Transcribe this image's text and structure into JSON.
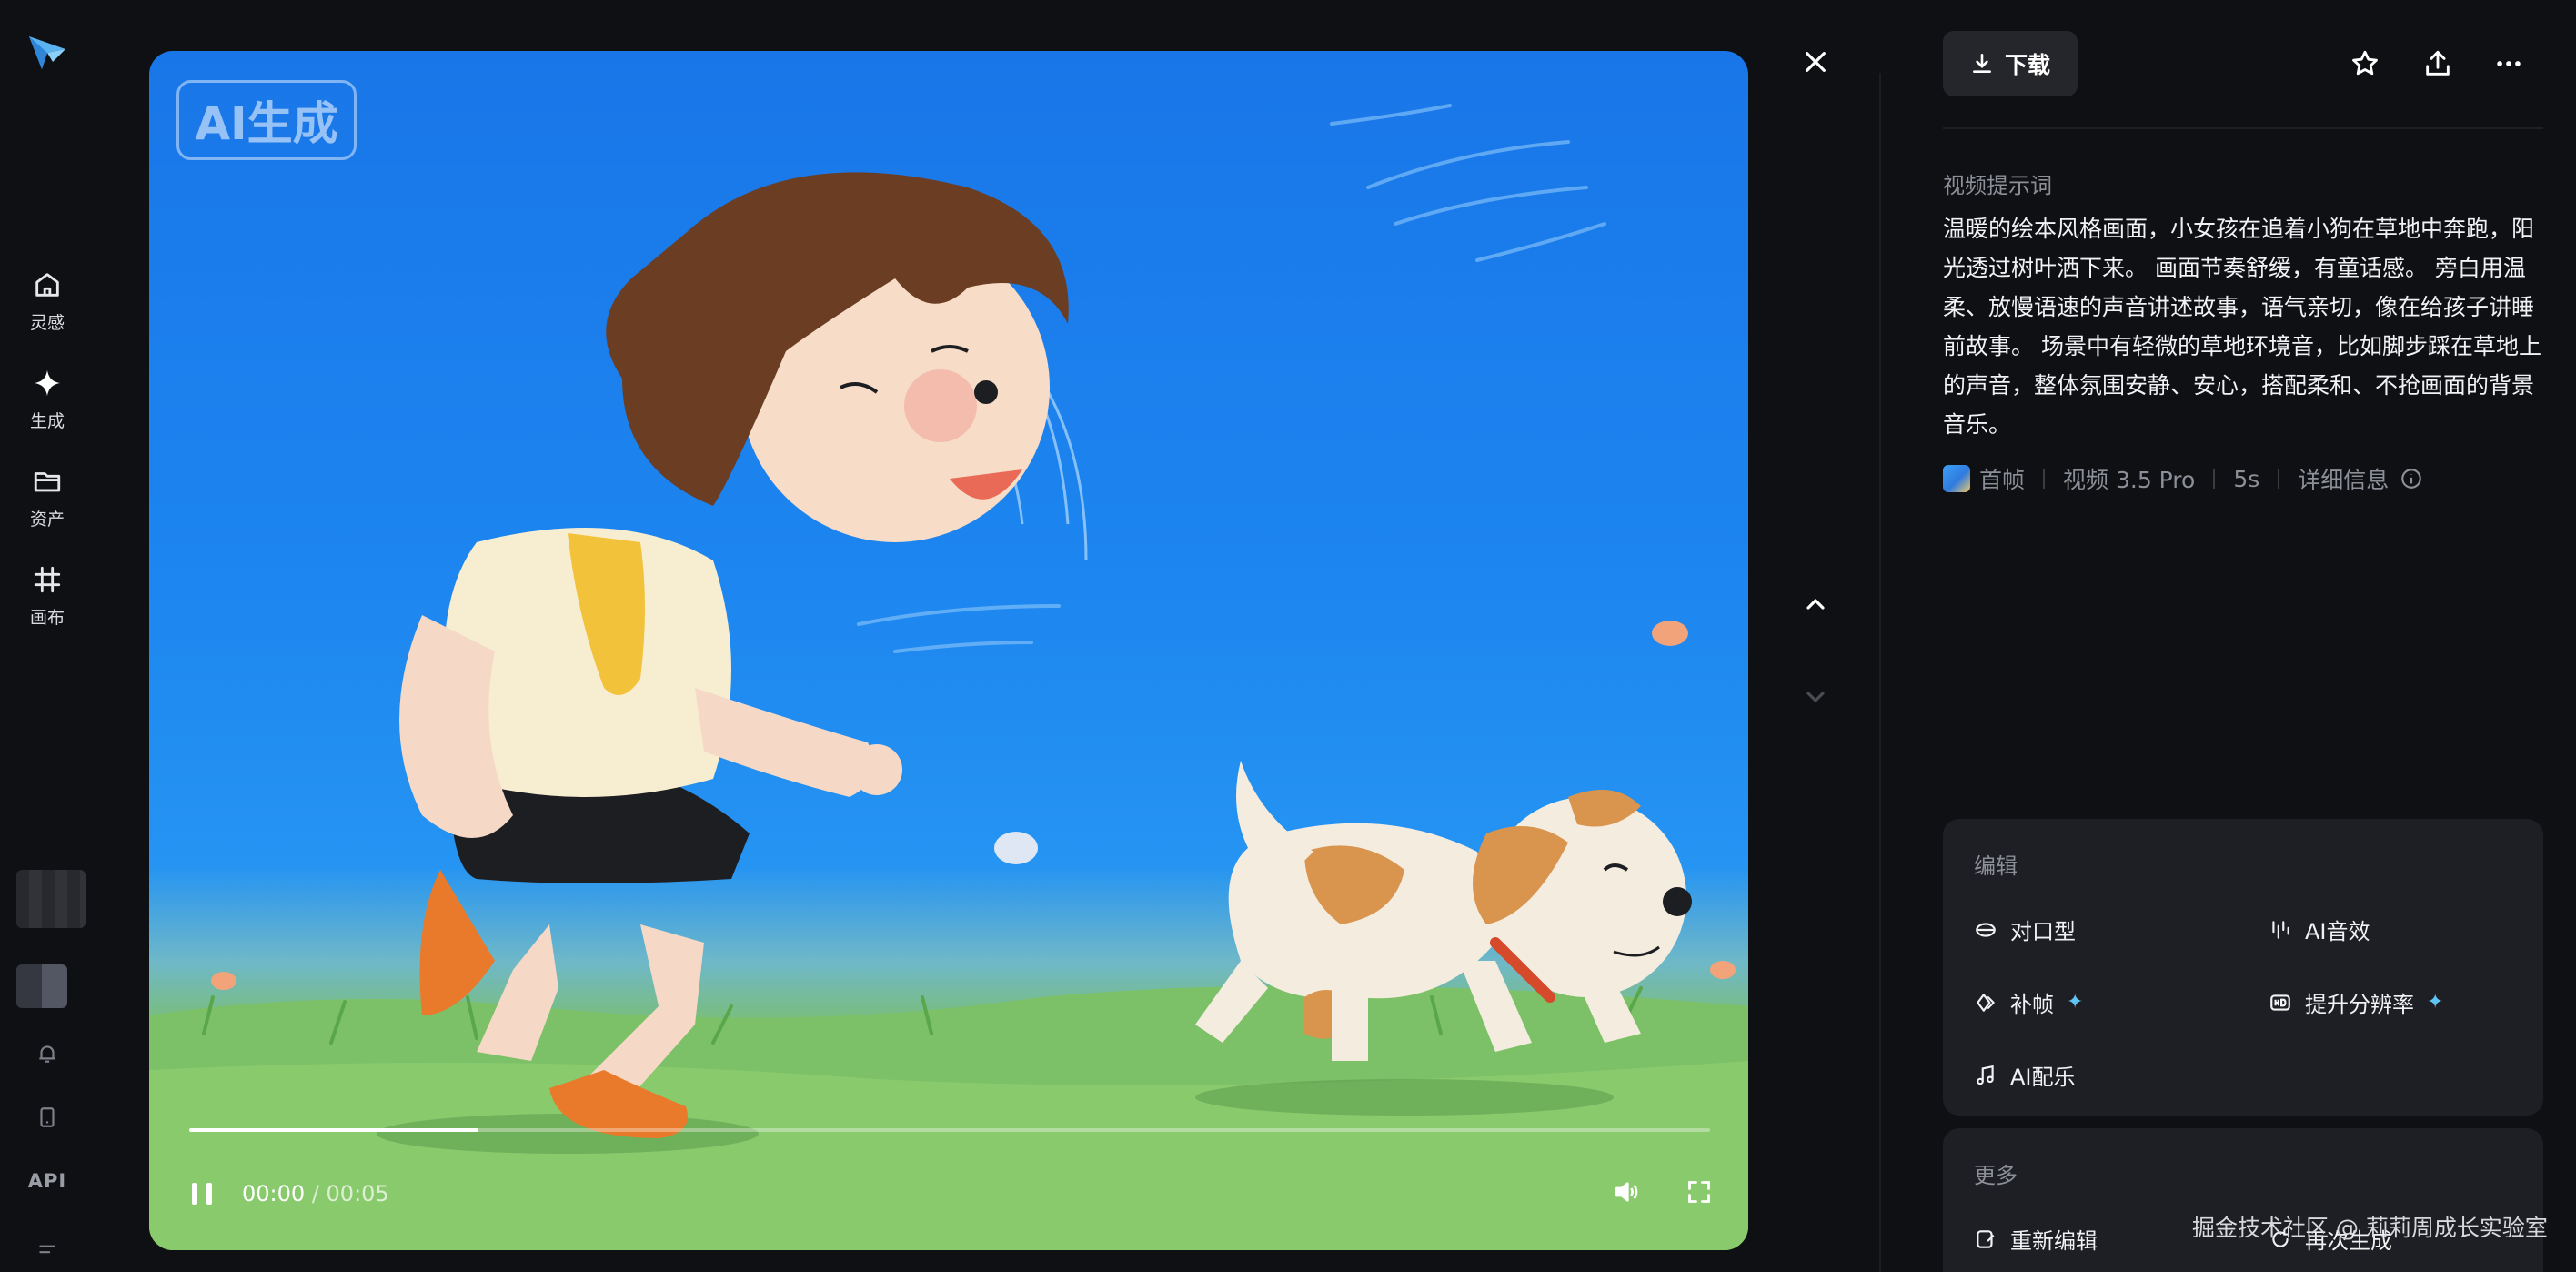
{
  "app": {
    "nav": [
      {
        "id": "inspiration",
        "label": "灵感"
      },
      {
        "id": "generate",
        "label": "生成"
      },
      {
        "id": "assets",
        "label": "资产"
      },
      {
        "id": "canvas",
        "label": "画布"
      }
    ],
    "api_label": "API"
  },
  "video": {
    "badge": "AI生成",
    "current_time": "00:00",
    "duration": "/ 00:05",
    "progress_fraction": 0.19,
    "playing": true
  },
  "panel": {
    "download_label": "下载",
    "prompt_section_label": "视频提示词",
    "prompt_text": "温暖的绘本风格画面，小女孩在追着小狗在草地中奔跑，阳光透过树叶洒下来。 画面节奏舒缓，有童话感。 旁白用温柔、放慢语速的声音讲述故事，语气亲切，像在给孩子讲睡前故事。 场景中有轻微的草地环境音，比如脚步踩在草地上的声音，整体氛围安静、安心，搭配柔和、不抢画面的背景音乐。",
    "meta": {
      "first_frame": "首帧",
      "model": "视频 3.5 Pro",
      "length": "5s",
      "details": "详细信息"
    },
    "edit_card": {
      "title": "编辑",
      "tools": [
        {
          "id": "lip-sync",
          "label": "对口型",
          "icon": "lips-icon",
          "sparkle": false
        },
        {
          "id": "ai-sfx",
          "label": "AI音效",
          "icon": "audio-bars-icon",
          "sparkle": false
        },
        {
          "id": "frame-interp",
          "label": "补帧",
          "icon": "frames-icon",
          "sparkle": true
        },
        {
          "id": "upscale",
          "label": "提升分辨率",
          "icon": "hd-icon",
          "sparkle": true
        },
        {
          "id": "ai-music",
          "label": "AI配乐",
          "icon": "music-note-icon",
          "sparkle": false
        }
      ],
      "sparkle_glyph": "✦"
    },
    "more_card": {
      "title": "更多",
      "tools": [
        {
          "id": "re-edit",
          "label": "重新编辑",
          "icon": "edit-icon"
        },
        {
          "id": "regenerate",
          "label": "再次生成",
          "icon": "refresh-icon"
        }
      ]
    }
  },
  "watermark": "掘金技术社区 @ 莉莉周成长实验室",
  "colors": {
    "background": "#0f1013",
    "card": "#1e1f24",
    "accent_sparkle": "#5fc4f5",
    "muted_text": "#8c8f97"
  }
}
